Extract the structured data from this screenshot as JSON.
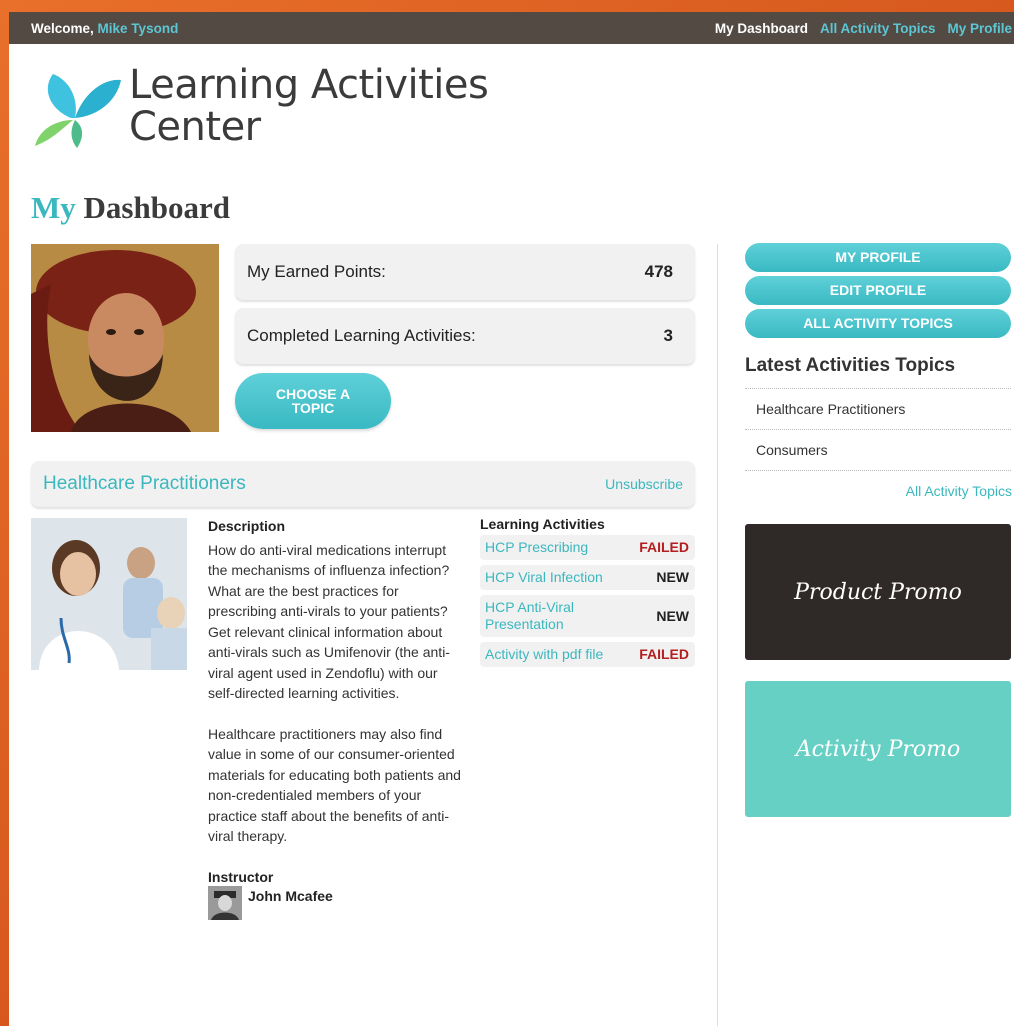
{
  "topbar": {
    "welcome": "Welcome,",
    "user_name": "Mike Tysond",
    "nav": [
      "My Dashboard",
      "All Activity Topics",
      "My Profile"
    ]
  },
  "logo": {
    "line1": "Learning Activities",
    "line2": "Center"
  },
  "page_title": {
    "accent": "My",
    "rest": " Dashboard"
  },
  "stats": {
    "points_label": "My Earned Points:",
    "points_value": "478",
    "completed_label": "Completed Learning Activities:",
    "completed_value": "3"
  },
  "choose_topic": {
    "line1": "CHOOSE A",
    "line2": "TOPIC"
  },
  "topic": {
    "title": "Healthcare Practitioners",
    "unsubscribe": "Unsubscribe",
    "description_heading": "Description",
    "description_p1": "How do anti-viral medications interrupt the mechanisms of influenza infection? What are the best practices for prescribing anti-virals to your patients? Get relevant clinical information about anti-virals such as Umifenovir (the anti-viral agent used in Zendoflu) with our self-directed learning activities.",
    "description_p2": "Healthcare practitioners may also find value in some of our consumer-oriented materials for educating both patients and non-credentialed members of your practice staff about the benefits of anti-viral therapy.",
    "instructor_heading": "Instructor",
    "instructor_name": "John Mcafee",
    "activities_heading": "Learning Activities",
    "activities": [
      {
        "name": "HCP Prescribing",
        "status": "FAILED"
      },
      {
        "name": "HCP Viral Infection",
        "status": "NEW"
      },
      {
        "name": "HCP Anti-Viral Presentation",
        "status": "NEW"
      },
      {
        "name": "Activity with pdf file",
        "status": "FAILED"
      }
    ]
  },
  "sidebar": {
    "buttons": [
      "MY PROFILE",
      "EDIT PROFILE",
      "ALL ACTIVITY TOPICS"
    ],
    "latest_title": "Latest Activities Topics",
    "latest_items": [
      "Healthcare Practitioners",
      "Consumers"
    ],
    "all_link": "All Activity Topics",
    "promo1": "Product Promo",
    "promo2": "Activity Promo"
  },
  "colors": {
    "accent": "#3bb7be",
    "topbar": "#534a44",
    "failed": "#b31f1f",
    "promo_dark": "#2f2a27",
    "promo_teal": "#66d0c4"
  }
}
